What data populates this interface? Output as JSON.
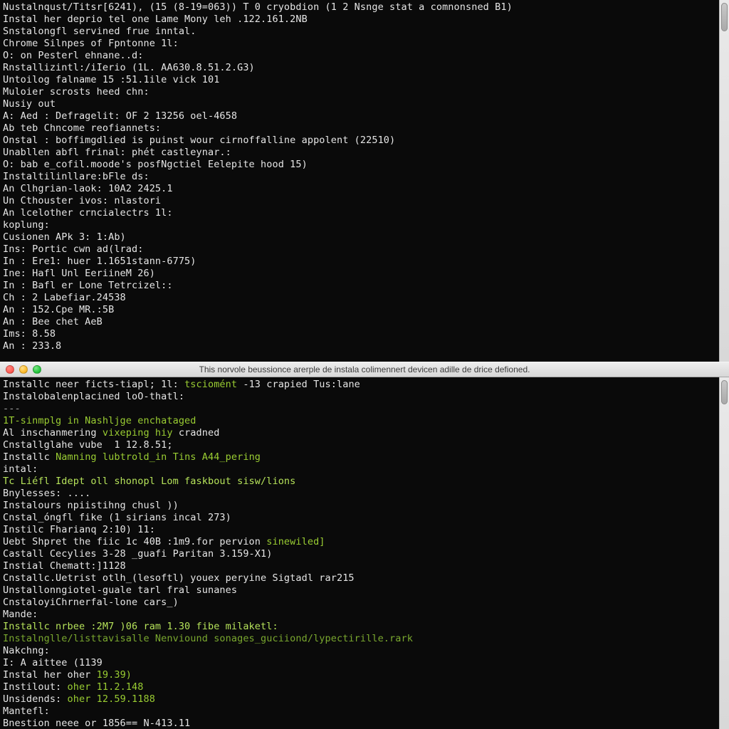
{
  "top_pane": {
    "lines": [
      [
        {
          "text": "Nustalnqust/Titsr[6241), (15 (8-19=063)) T 0 cryobdion (1 2 Nsnge stat a comnonsned B1)",
          "cls": "white"
        }
      ],
      [
        {
          "text": "Instal her deprio tel one Lame Mony leh .122.161.2NB",
          "cls": "white"
        }
      ],
      [
        {
          "text": "Snstalongfl servined frue inntal.",
          "cls": "white"
        }
      ],
      [
        {
          "text": "Chrome Silnpes of Fpntonne 1l:",
          "cls": "white"
        }
      ],
      [
        {
          "text": "O: on Pesterl ehnane..d:",
          "cls": "white"
        }
      ],
      [
        {
          "text": "Rnstallizintl:/iIerio (1L. AA630.8.51.2.G3)",
          "cls": "white"
        }
      ],
      [
        {
          "text": "Untoilog falname 15 :51.1ile vick 101",
          "cls": "white"
        }
      ],
      [
        {
          "text": "Muloier scrosts heed chn:",
          "cls": "white"
        }
      ],
      [
        {
          "text": "Nusiy out",
          "cls": "white"
        }
      ],
      [
        {
          "text": "A: Aed : Defragelit: OF 2 13256 oel-4658",
          "cls": "white"
        }
      ],
      [
        {
          "text": "Ab teb Chncome reofiannets:",
          "cls": "white"
        }
      ],
      [
        {
          "text": "Onstal : boffimgdlied is puinst wour cirnoffalline appolent (22510)",
          "cls": "white"
        }
      ],
      [
        {
          "text": "Unabllen abfl frinal: phét castleynar.:",
          "cls": "white"
        }
      ],
      [
        {
          "text": "O: bab e_cofil.moode's posfNgctiel Eelepite hood 15)",
          "cls": "white"
        }
      ],
      [
        {
          "text": "Instaltilinllare:bFle ds:",
          "cls": "white"
        }
      ],
      [
        {
          "text": "An Clhgrian-laok: 10A2 2425.1",
          "cls": "white"
        }
      ],
      [
        {
          "text": "Un Cthouster ivos: nlastori",
          "cls": "white"
        }
      ],
      [
        {
          "text": "An lcelother crncialectrs 1l:",
          "cls": "white"
        }
      ],
      [
        {
          "text": "koplung:",
          "cls": "white"
        }
      ],
      [
        {
          "text": "Cusionen APk 3: 1:Ab)",
          "cls": "white"
        }
      ],
      [
        {
          "text": "Ins: Portic cwn ad(lrad:",
          "cls": "white"
        }
      ],
      [
        {
          "text": "In : Ere1: huer 1.1651stann-6775)",
          "cls": "white"
        }
      ],
      [
        {
          "text": "Ine: Hafl Unl EeriineM 26)",
          "cls": "white"
        }
      ],
      [
        {
          "text": "In : Bafl er Lone Tetrcizel::",
          "cls": "white"
        }
      ],
      [
        {
          "text": "Ch : 2 Labefiar.24538",
          "cls": "white"
        }
      ],
      [
        {
          "text": "An : 152.Cpe MR.:5B",
          "cls": "white"
        }
      ],
      [
        {
          "text": "An : Bee chet AeB",
          "cls": "white"
        }
      ],
      [
        {
          "text": "Ims: 8.58",
          "cls": "white"
        }
      ],
      [
        {
          "text": "An : 233.8",
          "cls": "white"
        }
      ]
    ]
  },
  "bottom_pane": {
    "title": "This norvole beussionce arerple de instala colimennert devicen adille de drice defioned.",
    "lines": [
      [
        {
          "text": "Installc neer ficts-tiapl; 1l: ",
          "cls": "white"
        },
        {
          "text": "tsciomént ",
          "cls": "green"
        },
        {
          "text": "-13 crapied Tus:lane",
          "cls": "white"
        }
      ],
      [
        {
          "text": "Instalobalenplacined loO-thatl:",
          "cls": "white"
        }
      ],
      [
        {
          "text": "---",
          "cls": "gray"
        }
      ],
      [
        {
          "text": "1T-sinmplg in Nashljge enchataged",
          "cls": "green"
        }
      ],
      [
        {
          "text": "Al inschanmering ",
          "cls": "white"
        },
        {
          "text": "vixeping hiy ",
          "cls": "green"
        },
        {
          "text": "cradned",
          "cls": "white"
        }
      ],
      [
        {
          "text": "Cnstallglahe vube  1 12.8.51;",
          "cls": "white"
        }
      ],
      [
        {
          "text": "Installc ",
          "cls": "white"
        },
        {
          "text": "Namning lubtrold_in Tins A44_pering",
          "cls": "green"
        }
      ],
      [
        {
          "text": "intal:",
          "cls": "white"
        }
      ],
      [
        {
          "text": "Tc Liéfl Idept oll shonopl Lom faskbout sisw/lions",
          "cls": "brightgreen"
        }
      ],
      [
        {
          "text": "Bnylesses: ....",
          "cls": "white"
        }
      ],
      [
        {
          "text": "Instalours npiistihng chusl ))",
          "cls": "white"
        }
      ],
      [
        {
          "text": "Cnstal_óngfl fike (1 sirians incal 273)",
          "cls": "white"
        }
      ],
      [
        {
          "text": "Instilc Fharianq 2:10) 11:",
          "cls": "white"
        }
      ],
      [
        {
          "text": "Uebt Shpret the fiic 1c 40B :1m9.for pervion ",
          "cls": "white"
        },
        {
          "text": "sinewiled]",
          "cls": "green"
        }
      ],
      [
        {
          "text": "Castall Cecylies 3-28 _guafi Paritan 3.159-X1)",
          "cls": "white"
        }
      ],
      [
        {
          "text": "Instial Chematt:]1128",
          "cls": "white"
        }
      ],
      [
        {
          "text": "Cnstallc.Uetrist otlh_(lesoftl) youex peryine Sigtadl rar215",
          "cls": "white"
        }
      ],
      [
        {
          "text": "Unstallonngiotel-guale tarl fral sunanes",
          "cls": "white"
        }
      ],
      [
        {
          "text": "CnstaloyiChrnerfal-lone cars_)",
          "cls": "white"
        }
      ],
      [
        {
          "text": "Mande:",
          "cls": "white"
        }
      ],
      [
        {
          "text": "Installc nrbee :2M7 )06 ram 1.30 fibe milaketl:",
          "cls": "brightgreen"
        }
      ],
      [
        {
          "text": "Instalnglle/listtavisalle Nenviound sonages_guciiond/lypectirille.rark",
          "cls": "dimgreen"
        }
      ],
      [
        {
          "text": "Nakchng:",
          "cls": "white"
        }
      ],
      [
        {
          "text": "I: A aittee (1139",
          "cls": "white"
        }
      ],
      [
        {
          "text": "Instal her oher ",
          "cls": "white"
        },
        {
          "text": "19.39)",
          "cls": "green"
        }
      ],
      [
        {
          "text": "Instilout: ",
          "cls": "white"
        },
        {
          "text": "oher 11.2.148",
          "cls": "green"
        }
      ],
      [
        {
          "text": "Unsidends: ",
          "cls": "white"
        },
        {
          "text": "oher 12.59.1188",
          "cls": "green"
        }
      ],
      [
        {
          "text": "Mantefl:",
          "cls": "white"
        }
      ],
      [
        {
          "text": "Bnestion neee or 1856== N-413.11",
          "cls": "white"
        }
      ]
    ]
  }
}
